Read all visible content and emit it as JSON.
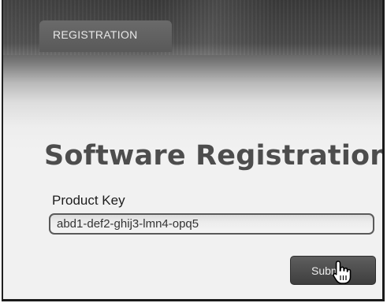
{
  "tab": {
    "label": "REGISTRATION"
  },
  "page": {
    "title": "Software Registration"
  },
  "form": {
    "product_key_label": "Product Key",
    "product_key_value": "abd1-def2-ghij3-lmn4-opq5",
    "submit_label": "Submit"
  },
  "cursor": {
    "icon": "hand-pointer-icon"
  },
  "colors": {
    "header_dark": "#3a3a3a",
    "tab_bg": "#5f5f5f",
    "title_text": "#4d4d4d",
    "button_bg": "#4a4a4a"
  }
}
